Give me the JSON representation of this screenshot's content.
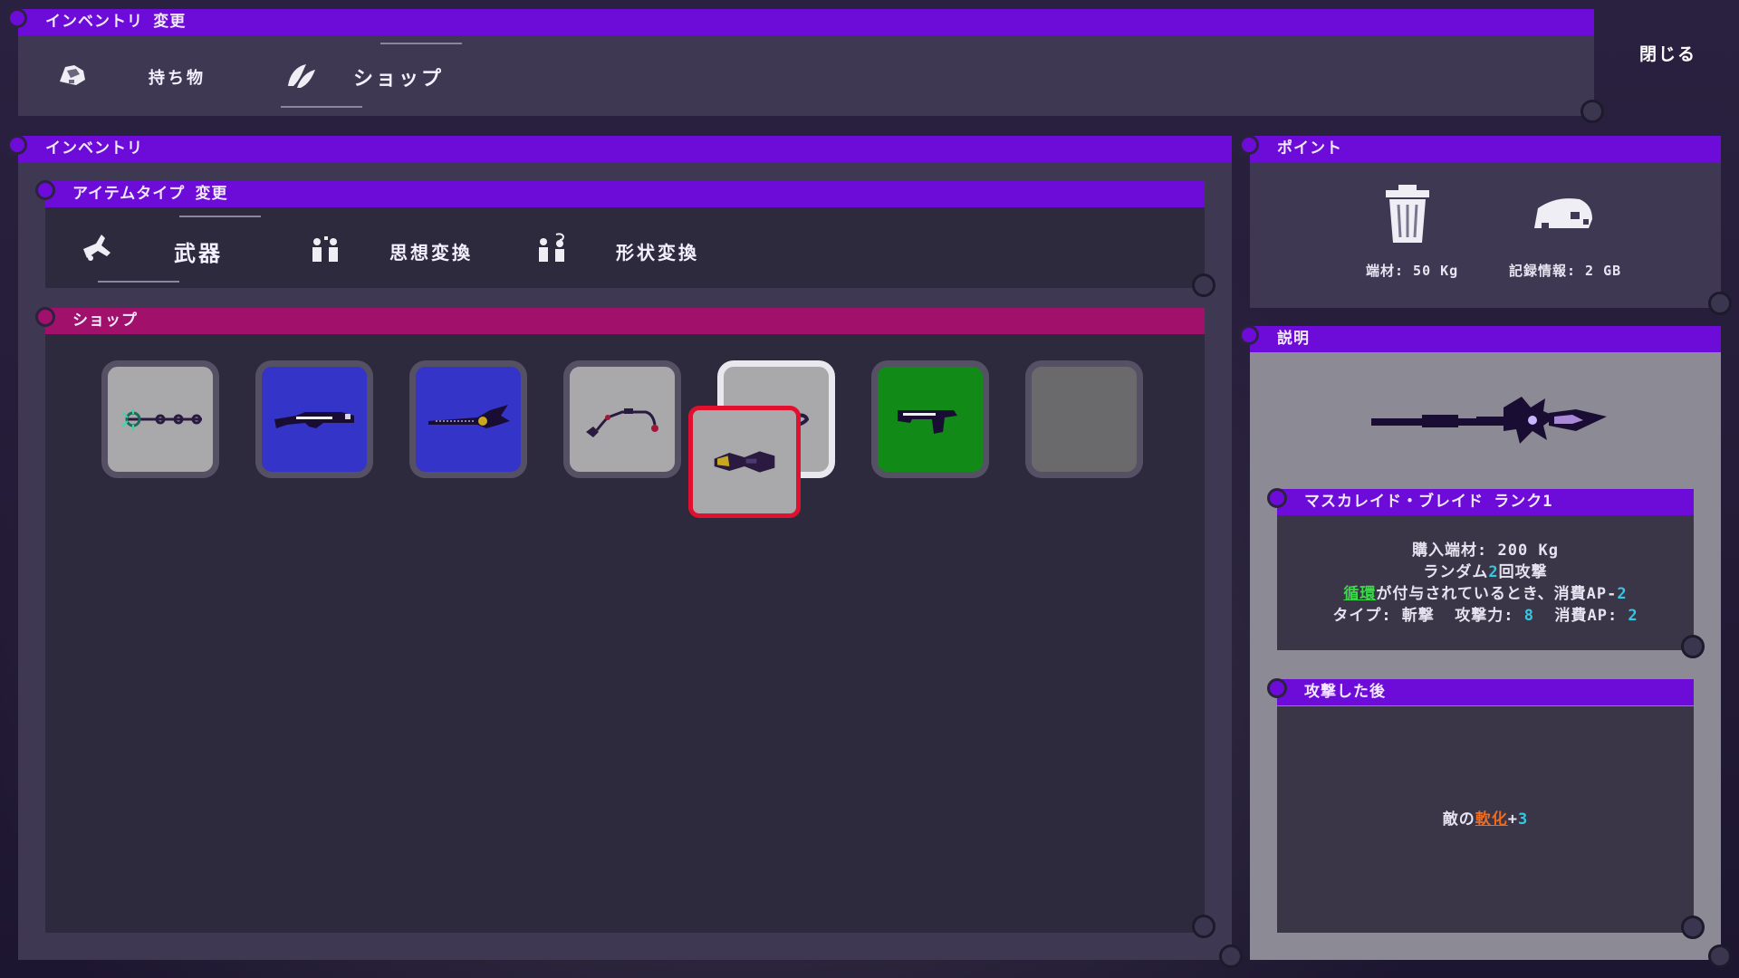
{
  "top_header": {
    "title": "インベントリ 変更"
  },
  "top_tabs": [
    {
      "label": "持ち物",
      "icon": "backpack-icon"
    },
    {
      "label": "ショップ",
      "icon": "shop-wings-icon"
    }
  ],
  "close_label": "閉じる",
  "inventory_panel": {
    "title": "インベントリ"
  },
  "item_type_panel": {
    "title": "アイテムタイプ 変更",
    "tabs": [
      {
        "label": "武器",
        "icon": "weapon-icon"
      },
      {
        "label": "思想変換",
        "icon": "thought-convert-icon"
      },
      {
        "label": "形状変換",
        "icon": "shape-convert-icon"
      }
    ]
  },
  "shop_panel": {
    "title": "ショップ",
    "slots": [
      {
        "item": "spiked-orb-staff-icon",
        "bg": "#a9a9ab"
      },
      {
        "item": "rifle-icon",
        "bg": "#3434c8"
      },
      {
        "item": "blade-icon",
        "bg": "#3434c8"
      },
      {
        "item": "chain-flail-icon",
        "bg": "#a9a9ab"
      },
      {
        "item": "hook-icon",
        "bg": "#a9a9ab",
        "selected": true
      },
      {
        "item": "pistol-icon",
        "bg": "#118a18"
      },
      {
        "item": "empty-slot",
        "bg": "#6a6a6c"
      }
    ],
    "dragged_item": {
      "item": "gauntlet-icon",
      "bg": "#a9a9ab",
      "border": "#e0102f"
    }
  },
  "point_panel": {
    "title": "ポイント",
    "materials": "端材: 50 Kg",
    "records": "記録情報: 2 GB"
  },
  "desc_panel": {
    "title": "説明",
    "item_name": "マスカレイド・ブレイド ランク1",
    "cost": "購入端材: 200 Kg",
    "line2_pre": "ランダム",
    "line2_num": "2",
    "line2_post": "回攻撃",
    "line3_keyword": "循環",
    "line3_mid": "が付与されているとき、消費AP-",
    "line3_num": "2",
    "line4_pre": "タイプ: 斬撃  攻撃力: ",
    "line4_atk": "8",
    "line4_mid": "  消費AP: ",
    "line4_ap": "2",
    "after_attack_title": "攻撃した後",
    "after_pre": "敵の",
    "after_keyword": "軟化",
    "after_plus": "+",
    "after_num": "3"
  },
  "colors": {
    "header_purple": "#6d0bd8",
    "header_magenta": "#a1106a",
    "slot_blue": "#3434c8",
    "slot_green": "#118a18",
    "slot_gray": "#a9a9ab",
    "drag_red": "#e0102f",
    "accent_green": "#3bd84a",
    "accent_cyan": "#32c8e6",
    "accent_orange": "#f06a1a"
  }
}
